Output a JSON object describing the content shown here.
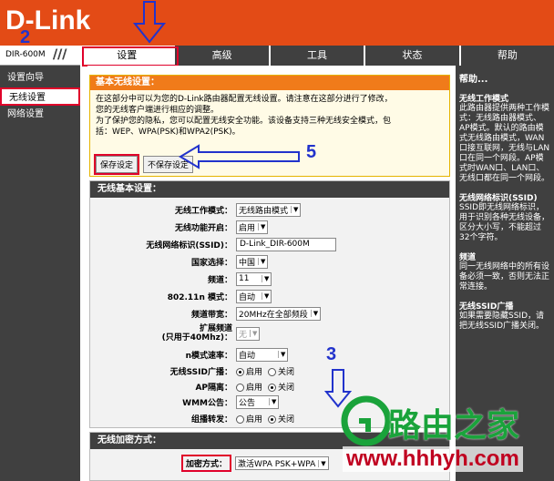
{
  "header": {
    "logo": "D-Link",
    "model": "DIR-600M"
  },
  "nav": {
    "tabs": [
      {
        "label": "设置"
      },
      {
        "label": "高级"
      },
      {
        "label": "工具"
      },
      {
        "label": "状态"
      },
      {
        "label": "帮助"
      }
    ]
  },
  "sidebar": {
    "items": [
      {
        "label": "设置向导"
      },
      {
        "label": "无线设置"
      },
      {
        "label": "网络设置"
      }
    ]
  },
  "intro": {
    "title": "基本无线设置：",
    "line1": "在这部分中可以为您的D-Link路由器配置无线设置。请注意在这部分进行了修改，",
    "line2": "您的无线客户端进行相应的调整。",
    "line3": "为了保护您的隐私，您可以配置无线安全功能。该设备支持三种无线安全模式，包",
    "line4": "括：WEP、WPA(PSK)和WPA2(PSK)。",
    "save_label": "保存设定",
    "nosave_label": "不保存设定"
  },
  "basic": {
    "title": "无线基本设置：",
    "mode_label": "无线工作模式：",
    "mode_value": "无线路由模式",
    "enable_label": "无线功能开启：",
    "enable_value": "启用",
    "ssid_label": "无线网络标识(SSID)：",
    "ssid_value": "D-Link_DIR-600M",
    "country_label": "国家选择：",
    "country_value": "中国",
    "channel_label": "频道：",
    "channel_value": "11",
    "n_mode_label": "802.11n 模式：",
    "n_mode_value": "自动",
    "bandwidth_label": "频道带宽：",
    "bandwidth_value": "20MHz在全部频段",
    "ext_label_1": "扩展频道",
    "ext_label_2": "(只用于40Mhz)：",
    "ext_value": "无",
    "rate_label": "n模式速率：",
    "rate_value": "自动",
    "ssid_bcast_label": "无线SSID广播：",
    "ap_iso_label": "AP隔离：",
    "wmm_label": "WMM公告：",
    "wmm_value": "公告",
    "multicast_label": "组播转发：",
    "enable_text": "启用",
    "disable_text": "关闭"
  },
  "encryption": {
    "title": "无线加密方式：",
    "label": "加密方式：",
    "value": "激活WPA PSK+WPA"
  },
  "help": {
    "heading": "帮助...",
    "t1": "无线工作模式",
    "p1": "此路由器提供两种工作模式：无线路由器模式、AP模式。默认的路由模式无线路由模式，WAN口接互联网，无线与LAN口在同一个网段。AP模式时WAN口、LAN口、无线口都在同一个网段。",
    "t2": "无线网络标识(SSID)",
    "p2": "SSID即无线网络标识，用于识别各种无线设备，区分大小写，不能超过32个字符。",
    "t3": "频道",
    "p3": "同一无线网络中的所有设备必须一致，否则无法正常连接。",
    "t4": "无线SSID广播",
    "p4": "如果需要隐藏SSID，请把无线SSID广播关闭。"
  },
  "annotations": {
    "n2": "2",
    "n3": "3",
    "n5": "5"
  },
  "watermark": {
    "text": "路由之家",
    "url": "www.hhhyh.com"
  },
  "colors": {
    "header": "#e34b16",
    "nav": "#404040",
    "highlight": "#e0002a",
    "annotation": "#2233cc"
  }
}
